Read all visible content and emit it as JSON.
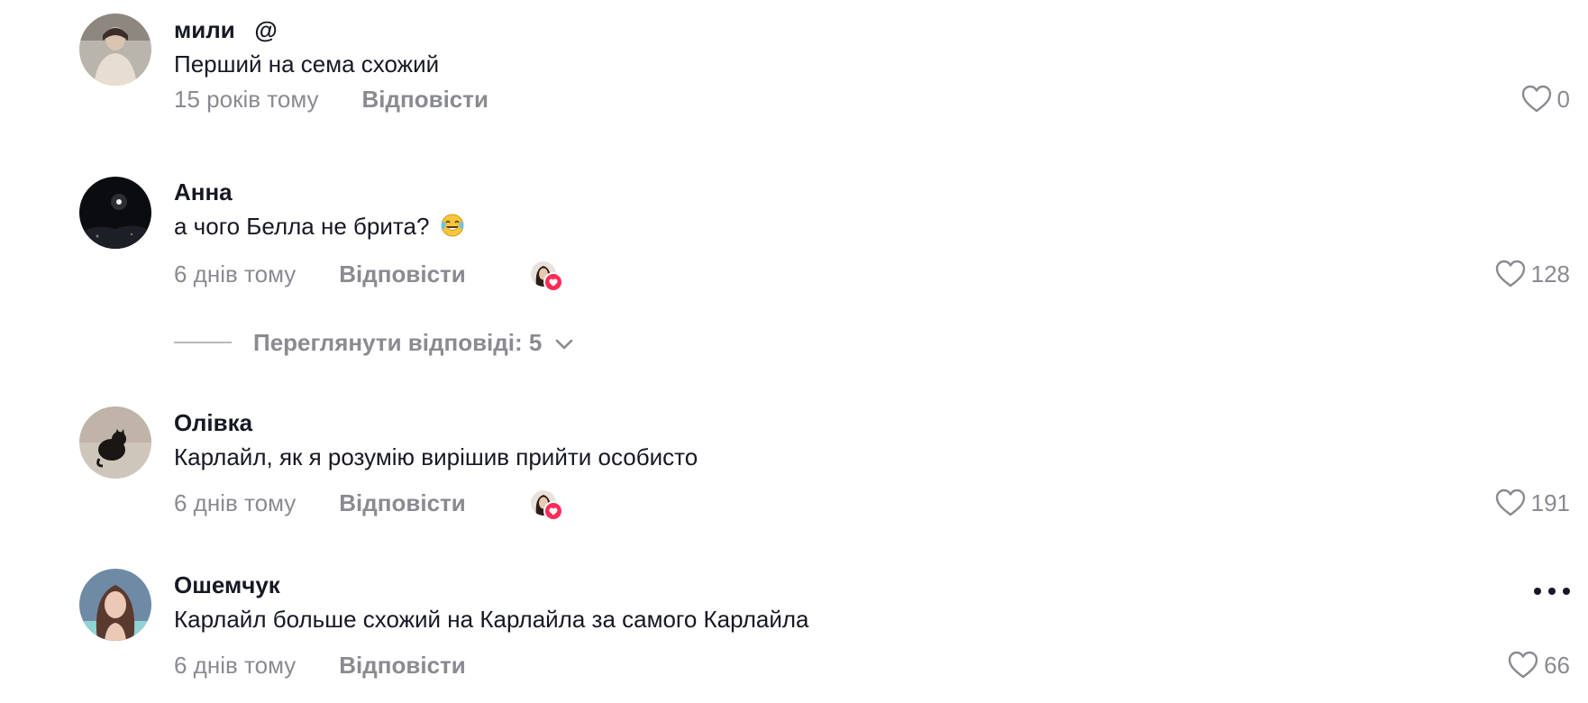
{
  "comments": [
    {
      "username": "мили   @",
      "text": "Перший на сема схожий",
      "date": "15 років тому",
      "reply_label": "Відповісти",
      "likes": "0",
      "creator_liked": false
    },
    {
      "username": "Анна",
      "text": "а чого Белла не брита?",
      "emoji": "laughing-tears-emoji",
      "date": "6 днів тому",
      "reply_label": "Відповісти",
      "likes": "128",
      "creator_liked": true
    },
    {
      "username": "Олівка",
      "text": "Карлайл, як я розумію вирішив прийти особисто",
      "date": "6 днів тому",
      "reply_label": "Відповісти",
      "likes": "191",
      "creator_liked": true
    },
    {
      "username": "Ошемчук",
      "text": "Карлайл больше схожий на Карлайла за самого Карлайла",
      "date": "6 днів тому",
      "reply_label": "Відповісти",
      "likes": "66",
      "creator_liked": false
    }
  ],
  "view_replies_label": "Переглянути відповіді: 5",
  "icons": {
    "like": "heart-outline-icon",
    "expand": "chevron-down-icon",
    "more": "more-options-icon",
    "creator_badge": "heart-badge-icon"
  },
  "colors": {
    "text_primary": "#161823",
    "text_secondary": "#8a8b91",
    "accent": "#fe2c55"
  }
}
